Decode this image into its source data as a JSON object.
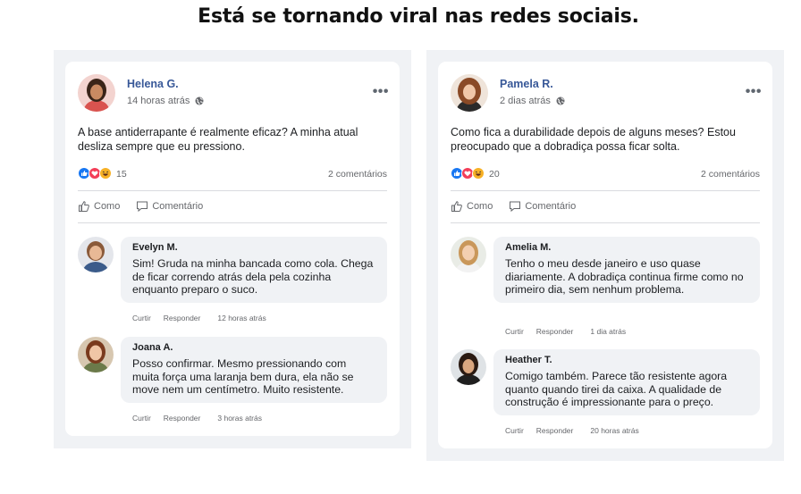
{
  "headline": "Está se tornando viral nas redes sociais.",
  "posts": [
    {
      "author": "Helena G.",
      "time": "14 horas atrás",
      "text": "A base antiderrapante é realmente eficaz? A minha atual desliza sempre que eu pressiono.",
      "reaction_count": "15",
      "comments_count": "2 comentários",
      "like_label": "Como",
      "comment_label": "Comentário",
      "comments": [
        {
          "name": "Evelyn M.",
          "text": "Sim! Gruda na minha bancada como cola. Chega de ficar correndo atrás dela pela cozinha enquanto preparo o suco.",
          "like": "Curtir",
          "reply": "Responder",
          "time": "12 horas atrás"
        },
        {
          "name": "Joana A.",
          "text": "Posso confirmar. Mesmo pressionando com muita força uma laranja bem dura, ela não se move nem um centímetro. Muito resistente.",
          "like": "Curtir",
          "reply": "Responder",
          "time": "3 horas atrás"
        }
      ]
    },
    {
      "author": "Pamela R.",
      "time": "2 dias atrás",
      "text": "Como fica a durabilidade depois de alguns meses? Estou preocupado que a dobradiça possa ficar solta.",
      "reaction_count": "20",
      "comments_count": "2 comentários",
      "like_label": "Como",
      "comment_label": "Comentário",
      "comments": [
        {
          "name": "Amelia M.",
          "text": "Tenho o meu desde janeiro e uso quase diariamente. A dobradiça continua firme como no primeiro dia, sem nenhum problema.",
          "like": "Curtir",
          "reply": "Responder",
          "time": "1 dia atrás"
        },
        {
          "name": "Heather T.",
          "text": "Comigo também. Parece tão resistente agora quanto quando tirei da caixa. A qualidade de construção é impressionante para o preço.",
          "like": "Curtir",
          "reply": "Responder",
          "time": "20 horas atrás"
        }
      ]
    }
  ],
  "colors": {
    "author_link": "#385898",
    "like_blue": "#1877f2",
    "love_red": "#f33e58",
    "haha_yellow": "#f7b125",
    "panel_bg": "#f0f2f5"
  },
  "icons": [
    "globe-icon",
    "more-options-icon",
    "like-reaction-icon",
    "love-reaction-icon",
    "haha-reaction-icon",
    "thumbs-up-icon",
    "comment-icon"
  ]
}
